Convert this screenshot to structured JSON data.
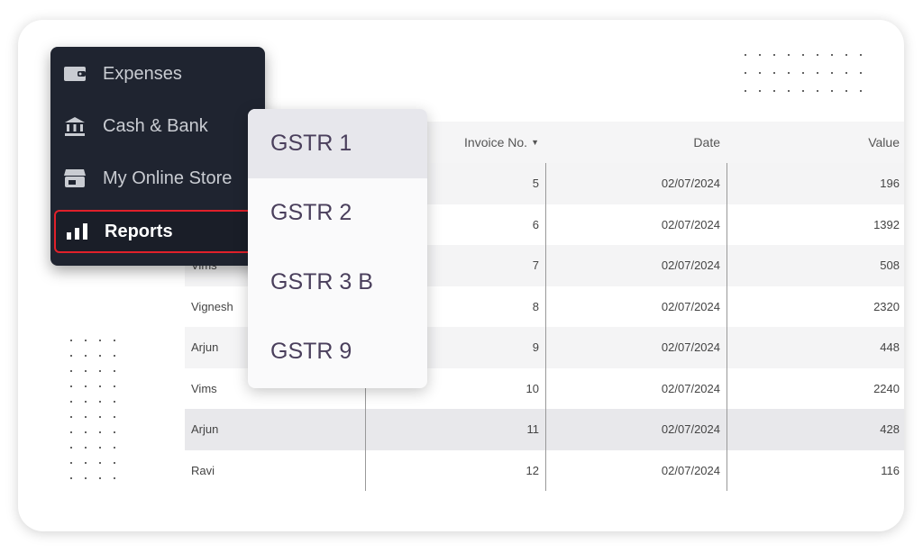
{
  "menu": {
    "items": [
      {
        "label": "Expenses",
        "icon": "wallet-icon"
      },
      {
        "label": "Cash & Bank",
        "icon": "bank-icon"
      },
      {
        "label": "My Online Store",
        "icon": "store-icon"
      },
      {
        "label": "Reports",
        "icon": "bar-chart-icon",
        "active": true
      }
    ]
  },
  "submenu": {
    "items": [
      "GSTR 1",
      "GSTR 2",
      "GSTR 3 B",
      "GSTR 9"
    ],
    "selected": "GSTR 1"
  },
  "table": {
    "headers": [
      "",
      "Invoice No.",
      "Date",
      "Value"
    ],
    "rows": [
      [
        "",
        "5",
        "02/07/2024",
        "196"
      ],
      [
        "",
        "6",
        "02/07/2024",
        "1392"
      ],
      [
        "Vims",
        "7",
        "02/07/2024",
        "508"
      ],
      [
        "Vignesh",
        "8",
        "02/07/2024",
        "2320"
      ],
      [
        "Arjun",
        "9",
        "02/07/2024",
        "448"
      ],
      [
        "Vims",
        "10",
        "02/07/2024",
        "2240"
      ],
      [
        "Arjun",
        "11",
        "02/07/2024",
        "428"
      ],
      [
        "Ravi",
        "12",
        "02/07/2024",
        "116"
      ]
    ]
  },
  "colors": {
    "menu_bg": "#1f2430",
    "active_border": "#e0202a",
    "submenu_text": "#4a3f5c"
  }
}
